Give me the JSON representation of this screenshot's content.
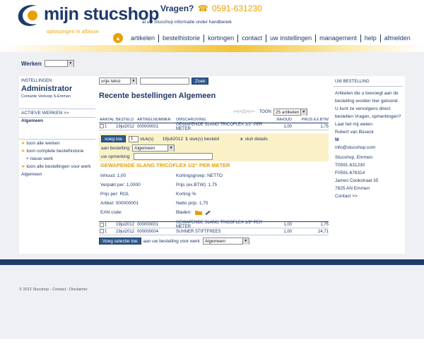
{
  "header": {
    "logo_text": "mijn stucshop",
    "logo_tag": "oplossingen in afbouw",
    "tagline": "al uw Stucshop informatie onder handbereik",
    "vragen_label": "Vragen?",
    "vragen_phone": "0591-631230"
  },
  "nav": {
    "items": [
      "artikelen",
      "bestelhistorie",
      "kortingen",
      "contact",
      "uw instellingen",
      "management",
      "help",
      "afmelden"
    ]
  },
  "werken": {
    "label": "Werken",
    "value": ""
  },
  "left": {
    "instellingen": "INSTELLINGEN",
    "user": "Administrator",
    "sub": "Contante Verkoop S-Emmen",
    "actieve": "ACTIEVE WERKEN >>",
    "algemeen": "Algemeen",
    "links": [
      "toon alle werken",
      "toon complete bestelhistorie",
      "+ nieuw werk",
      "toon alle bestellingen voor werk"
    ],
    "link_last": "Algemeen"
  },
  "search": {
    "select": "vrije tekst",
    "input": "",
    "button": "Zoek"
  },
  "main": {
    "title": "Recente bestellingen Algemeen",
    "pager": "<<|<|1|>|>>",
    "toon_label": "TOON",
    "toon_value": "25 artikelen"
  },
  "table": {
    "headers": [
      "AANTAL",
      "BESTELD",
      "ARTIKELNUMMER",
      "OMSCHRIJVING",
      "INHOUD",
      "PRIJS EX.BTW"
    ],
    "rows": [
      {
        "aantal": "1",
        "besteld": "19jul2012",
        "artikel": "000000001",
        "omschrijving": "GEWAPENDE SLANG TRICOFLEX 1/2\" PER METER",
        "inhoud": "1,00",
        "prijs": "1,75"
      }
    ]
  },
  "order_panel": {
    "voeg_toe": "voeg toe",
    "qty": "1",
    "qty_unit": "stuk(s)",
    "ordered_date": "19juli2012",
    "ordered_qty": "1",
    "ordered_text": "stuk(s) besteld",
    "close_x": "x",
    "close_text": "sluit details",
    "aan_bestelling": "aan bestelling",
    "aan_bestelling_value": "Algemeen",
    "opmerking": "uw opmerking",
    "opmerking_value": ""
  },
  "product": {
    "title": "GEWAPENDE SLANG TRICOFLEX 1/2\" PER METER",
    "left": [
      "Inhoud: 1,00",
      "Verpakt per: 1,0000",
      "Prijs per: ROL",
      "Artikel: 000000001",
      "EAN code:"
    ],
    "right": [
      "Kortingsgroep: NETTO",
      "Prijs (ex.BTW): 1,75",
      "Korting %:",
      "Netto prijs: 1,75",
      "Bladen:"
    ]
  },
  "table2": {
    "rows": [
      {
        "aantal": "1",
        "besteld": "19jul2012",
        "artikel": "000000001",
        "omschrijving": "GEWAPENDE SLANG TRICOFLEX 1/2\" PER METER",
        "inhoud": "1,00",
        "prijs": "1,75"
      },
      {
        "aantal": "1",
        "besteld": "19jul2012",
        "artikel": "000000004",
        "omschrijving": "SUHNER STIFTFREES",
        "inhoud": "1,00",
        "prijs": "24,71"
      }
    ]
  },
  "voeg_selectie": {
    "button": "Voeg selectie toe",
    "text": "aan uw bestelling voor werk",
    "value": "Algemeen"
  },
  "right": {
    "head": "UW BESTELLING",
    "lines": [
      "Artikelen die u toevoegt aan de",
      "bestelling worden hier getoond.",
      "U kunt ze vervolgens direct",
      "bestellen Vragen, opmerkingen?",
      "Laat het mij weten:",
      "Robert van Büseck",
      "M",
      "info@stucshop.com",
      "Stucshop, Emmen",
      "T0591-631230",
      "F0591-676314",
      "James Cookstraat 35",
      "7825 AN  Emmen",
      "Contact >>"
    ]
  },
  "footer": "© 2012 Stucshop - Contact - Disclaimer"
}
